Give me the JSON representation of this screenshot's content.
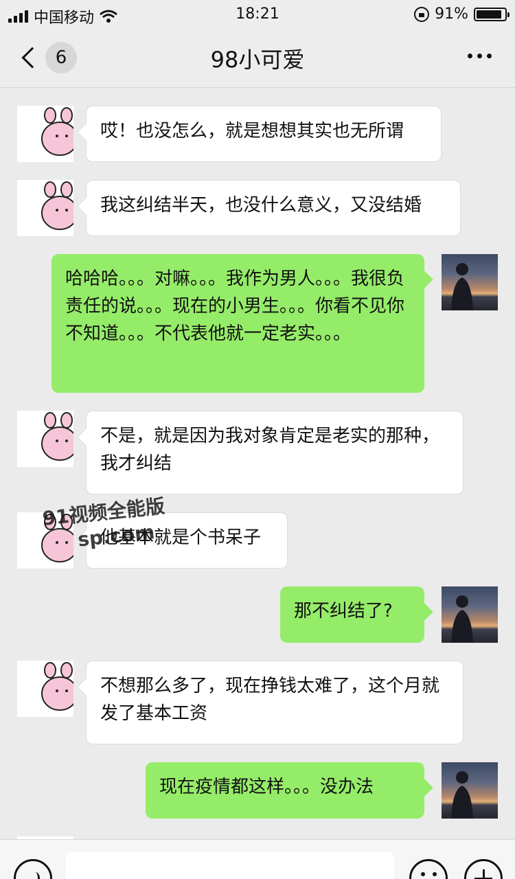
{
  "status_bar": {
    "carrier": "中国移动",
    "time": "18:21",
    "battery_percent": "91%",
    "battery_level": 0.91
  },
  "nav": {
    "unread_count": "6",
    "title": "98小可爱"
  },
  "messages": [
    {
      "side": "left",
      "text": "哎！也没怎么，就是想想其实也无所谓"
    },
    {
      "side": "left",
      "text": "我这纠结半天，也没什么意义，又没结婚"
    },
    {
      "side": "right",
      "text": "哈哈哈。。。对嘛。。。我作为男人。。。我很负责任的说。。。现在的小男生。。。你看不见你不知道。。。不代表他就一定老实。。。"
    },
    {
      "side": "left",
      "text": "不是，就是因为我对象肯定是老实的那种，我才纠结"
    },
    {
      "side": "left",
      "text": "他基本就是个书呆子"
    },
    {
      "side": "right",
      "text": "那不纠结了?"
    },
    {
      "side": "left",
      "text": "不想那么多了，现在挣钱太难了，这个月就发了基本工资"
    },
    {
      "side": "right",
      "text": "现在疫情都这样。。。没办法"
    }
  ],
  "watermark": {
    "line1": "91视频全能版",
    "line2": "sp.com"
  },
  "icons": {
    "avatar_left": "bunny-avatar",
    "avatar_right": "silhouette-sunset-avatar",
    "back": "chevron-left-icon",
    "more": "more-dots-icon",
    "voice": "voice-icon",
    "emoji": "emoji-icon",
    "plus": "plus-icon"
  },
  "colors": {
    "bubble_right": "#95ec69",
    "bubble_left": "#ffffff",
    "background": "#ebebeb"
  }
}
